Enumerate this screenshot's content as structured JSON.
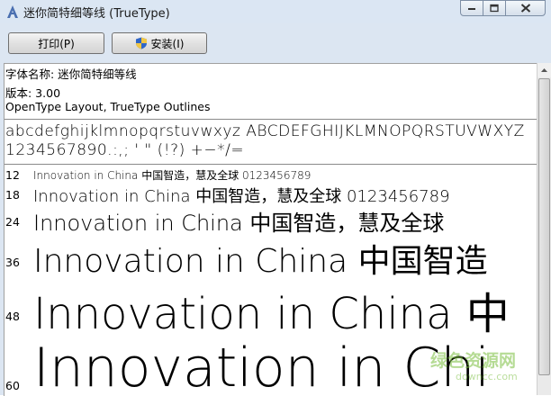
{
  "window": {
    "title": "迷你简特细等线 (TrueType)"
  },
  "toolbar": {
    "print_label": "打印(P)",
    "install_label": "安装(I)"
  },
  "info": {
    "font_name": "字体名称: 迷你简特细等线",
    "version": "版本: 3.00",
    "outline": "OpenType Layout, TrueType Outlines"
  },
  "charset": {
    "line1": "abcdefghijklmnopqrstuvwxyz  ABCDEFGHIJKLMNOPQRSTUVWXYZ",
    "line2": "1234567890.:,;  '  \"  (!?)  +−*/="
  },
  "samples": [
    {
      "size": "12",
      "text": "Innovation in China 中国智造，慧及全球 0123456789"
    },
    {
      "size": "18",
      "text": "Innovation in China 中国智造，慧及全球 0123456789"
    },
    {
      "size": "24",
      "text": "Innovation in China 中国智造，慧及全球"
    },
    {
      "size": "36",
      "text": "Innovation in China 中国智造"
    },
    {
      "size": "48",
      "text": "Innovation in China 中"
    },
    {
      "size": "60",
      "text": "Innovation in Chi"
    }
  ],
  "watermark": {
    "text": "绿色资源网",
    "url": "downcc.com"
  }
}
